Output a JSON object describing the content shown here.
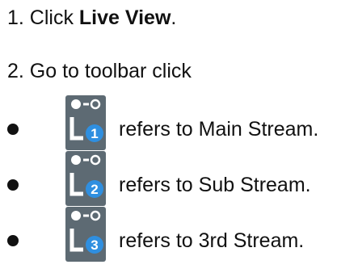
{
  "steps": {
    "step1": {
      "prefix": "1.  Click ",
      "bold": "Live View",
      "suffix": "."
    },
    "step2": {
      "text": "2.  Go to toolbar click"
    }
  },
  "streams": [
    {
      "icon_number": "1",
      "text": "refers to Main Stream."
    },
    {
      "icon_number": "2",
      "text": "refers to Sub Stream."
    },
    {
      "icon_number": "3",
      "text": "refers to 3rd Stream."
    }
  ],
  "colors": {
    "text": "#111111",
    "icon_bg": "#5d6a73",
    "icon_badge": "#2f8fe0",
    "icon_glyph": "#ffffff"
  }
}
